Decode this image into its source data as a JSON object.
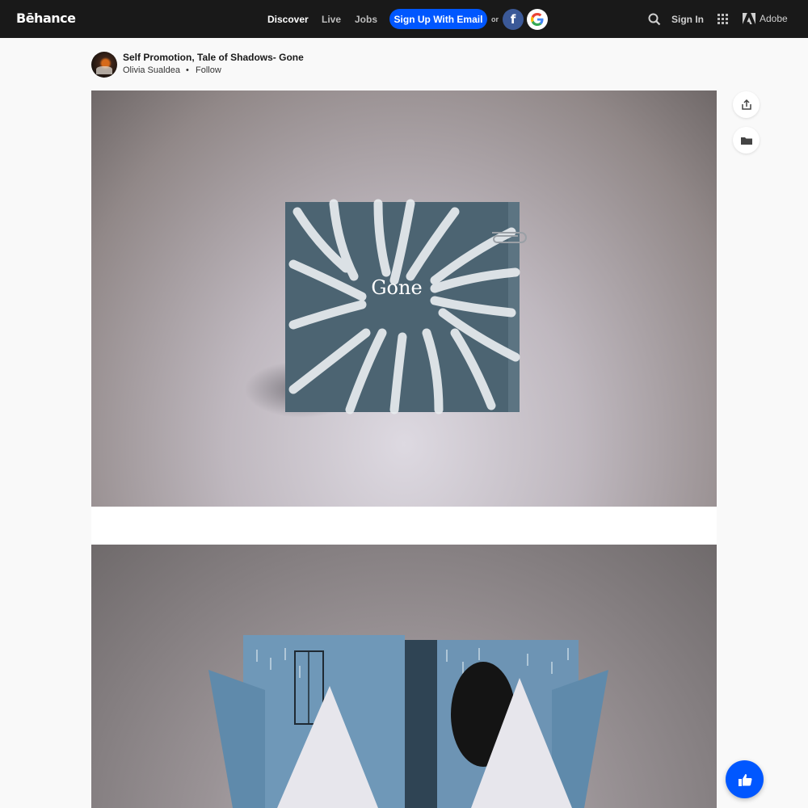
{
  "nav": {
    "logo": "Bēhance",
    "links": [
      "Discover",
      "Live",
      "Jobs"
    ],
    "signup_label": "Sign Up With Email",
    "or": "or",
    "facebook_glyph": "f",
    "signin": "Sign In",
    "adobe": "Adobe",
    "accent": "#0057ff"
  },
  "project": {
    "title": "Self Promotion, Tale of Shadows- Gone",
    "owner": "Olivia Sualdea",
    "separator": "•",
    "follow": "Follow",
    "cover_lettering": "Gone"
  },
  "actions": {
    "icons": [
      "share-icon",
      "folder-icon",
      "thumbs-up-icon"
    ]
  }
}
